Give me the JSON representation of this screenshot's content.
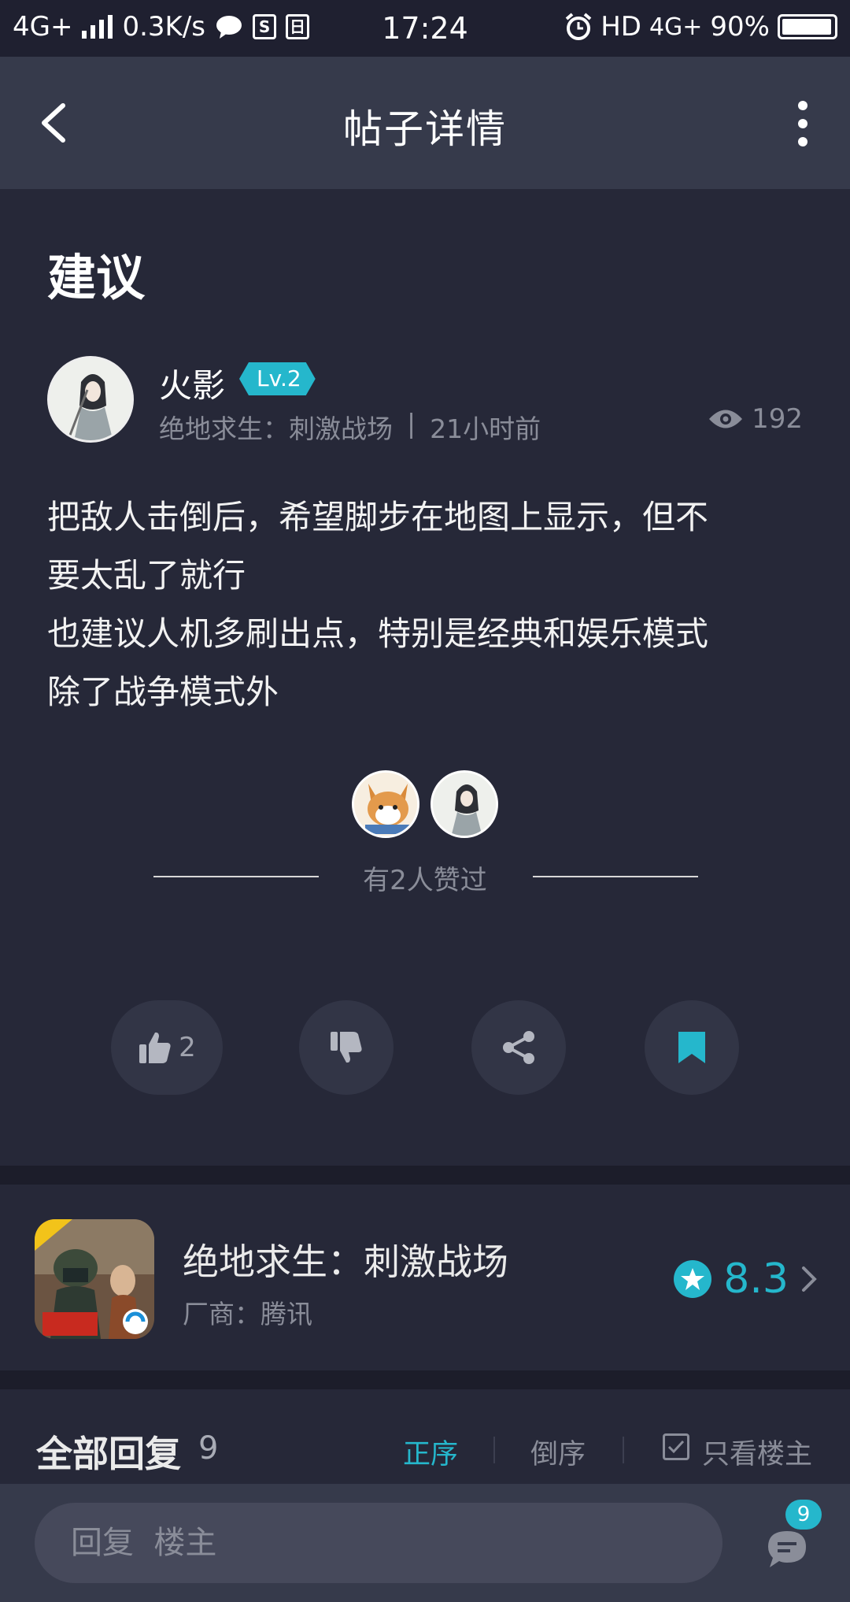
{
  "status_bar": {
    "network": "4G+",
    "speed": "0.3K/s",
    "time": "17:24",
    "hd": "HD",
    "network2": "4G+",
    "battery": "90%"
  },
  "header": {
    "title": "帖子详情"
  },
  "post": {
    "title": "建议",
    "author": "火影",
    "level": "Lv.2",
    "game": "绝地求生：刺激战场",
    "separator": "|",
    "time": "21小时前",
    "views": "192",
    "content": [
      "把敌人击倒后，希望脚步在地图上显示，但不",
      "要太乱了就行",
      "也建议人机多刷出点，特别是经典和娱乐模式",
      "除了战争模式外"
    ],
    "liked_text": "有2人赞过"
  },
  "actions": {
    "like_count": "2"
  },
  "game_card": {
    "name": "绝地求生：刺激战场",
    "vendor": "厂商：腾讯",
    "rating": "8.3"
  },
  "replies": {
    "title": "全部回复",
    "count": "9",
    "sort_asc": "正序",
    "sort_desc": "倒序",
    "only_op": "只看楼主"
  },
  "bottom": {
    "reply_placeholder": "回复  楼主",
    "comment_badge": "9"
  },
  "colors": {
    "accent": "#25b7cc",
    "background": "#262838",
    "header": "#363a4b"
  }
}
